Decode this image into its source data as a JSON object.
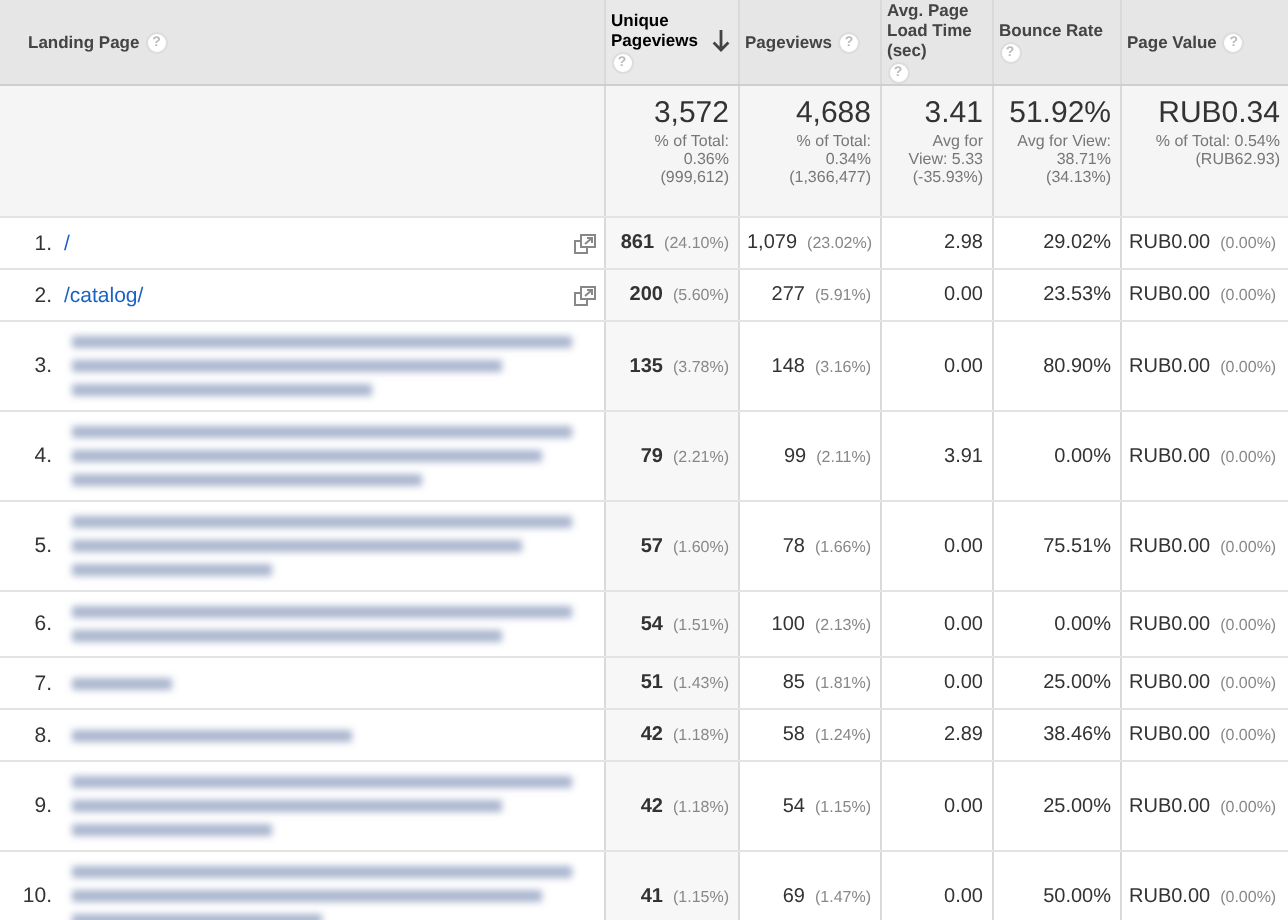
{
  "columns": [
    {
      "label": "Landing Page",
      "help": "?",
      "sorted": false
    },
    {
      "label": "Unique Pageviews",
      "help": "?",
      "sorted": true
    },
    {
      "label": "Pageviews",
      "help": "?",
      "sorted": false
    },
    {
      "label": "Avg. Page Load Time (sec)",
      "help": "?",
      "sorted": false
    },
    {
      "label": "Bounce Rate",
      "help": "?",
      "sorted": false
    },
    {
      "label": "Page Value",
      "help": "?",
      "sorted": false
    }
  ],
  "totals": [
    {
      "value": "3,572",
      "lines": [
        "% of Total:",
        "0.36%",
        "(999,612)"
      ]
    },
    {
      "value": "4,688",
      "lines": [
        "% of Total:",
        "0.34%",
        "(1,366,477)"
      ]
    },
    {
      "value": "3.41",
      "lines": [
        "Avg for",
        "View: 5.33",
        "(-35.93%)"
      ]
    },
    {
      "value": "51.92%",
      "lines": [
        "Avg for View:",
        "38.71%",
        "(34.13%)"
      ]
    },
    {
      "value": "RUB0.34",
      "lines": [
        "% of Total: 0.54%",
        "(RUB62.93)"
      ]
    }
  ],
  "rows": [
    {
      "index": "1.",
      "kind": "link",
      "page": "/",
      "unique": "861",
      "unique_pct": "(24.10%)",
      "pageviews": "1,079",
      "pageviews_pct": "(23.02%)",
      "load": "2.98",
      "bounce": "29.02%",
      "value": "RUB0.00",
      "value_pct": "(0.00%)"
    },
    {
      "index": "2.",
      "kind": "link",
      "page": "/catalog/",
      "unique": "200",
      "unique_pct": "(5.60%)",
      "pageviews": "277",
      "pageviews_pct": "(5.91%)",
      "load": "0.00",
      "bounce": "23.53%",
      "value": "RUB0.00",
      "value_pct": "(0.00%)"
    },
    {
      "index": "3.",
      "kind": "longblur",
      "unique": "135",
      "unique_pct": "(3.78%)",
      "pageviews": "148",
      "pageviews_pct": "(3.16%)",
      "load": "0.00",
      "bounce": "80.90%",
      "value": "RUB0.00",
      "value_pct": "(0.00%)"
    },
    {
      "index": "4.",
      "kind": "longblur",
      "unique": "79",
      "unique_pct": "(2.21%)",
      "pageviews": "99",
      "pageviews_pct": "(2.11%)",
      "load": "3.91",
      "bounce": "0.00%",
      "value": "RUB0.00",
      "value_pct": "(0.00%)"
    },
    {
      "index": "5.",
      "kind": "longblur",
      "unique": "57",
      "unique_pct": "(1.60%)",
      "pageviews": "78",
      "pageviews_pct": "(1.66%)",
      "load": "0.00",
      "bounce": "75.51%",
      "value": "RUB0.00",
      "value_pct": "(0.00%)"
    },
    {
      "index": "6.",
      "kind": "midblur",
      "unique": "54",
      "unique_pct": "(1.51%)",
      "pageviews": "100",
      "pageviews_pct": "(2.13%)",
      "load": "0.00",
      "bounce": "0.00%",
      "value": "RUB0.00",
      "value_pct": "(0.00%)"
    },
    {
      "index": "7.",
      "kind": "shortblur",
      "unique": "51",
      "unique_pct": "(1.43%)",
      "pageviews": "85",
      "pageviews_pct": "(1.81%)",
      "load": "0.00",
      "bounce": "25.00%",
      "value": "RUB0.00",
      "value_pct": "(0.00%)"
    },
    {
      "index": "8.",
      "kind": "shortblur",
      "unique": "42",
      "unique_pct": "(1.18%)",
      "pageviews": "58",
      "pageviews_pct": "(1.24%)",
      "load": "2.89",
      "bounce": "38.46%",
      "value": "RUB0.00",
      "value_pct": "(0.00%)"
    },
    {
      "index": "9.",
      "kind": "longblur",
      "unique": "42",
      "unique_pct": "(1.18%)",
      "pageviews": "54",
      "pageviews_pct": "(1.15%)",
      "load": "0.00",
      "bounce": "25.00%",
      "value": "RUB0.00",
      "value_pct": "(0.00%)"
    },
    {
      "index": "10.",
      "kind": "longblur",
      "unique": "41",
      "unique_pct": "(1.15%)",
      "pageviews": "69",
      "pageviews_pct": "(1.47%)",
      "load": "0.00",
      "bounce": "50.00%",
      "value": "RUB0.00",
      "value_pct": "(0.00%)"
    }
  ]
}
